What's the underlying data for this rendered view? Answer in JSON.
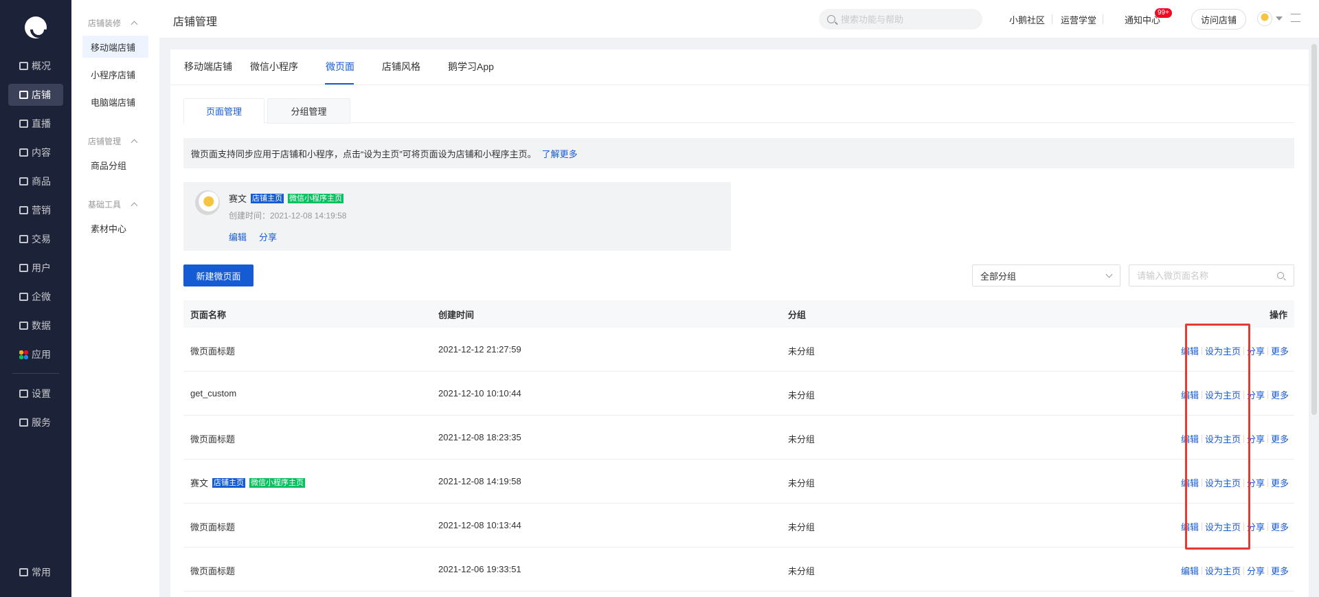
{
  "rail": {
    "items": [
      {
        "label": "概况"
      },
      {
        "label": "店铺"
      },
      {
        "label": "直播"
      },
      {
        "label": "内容"
      },
      {
        "label": "商品"
      },
      {
        "label": "营销"
      },
      {
        "label": "交易"
      },
      {
        "label": "用户"
      },
      {
        "label": "企微"
      },
      {
        "label": "数据"
      },
      {
        "label": "应用"
      },
      {
        "label": "设置"
      },
      {
        "label": "服务"
      },
      {
        "label": "常用"
      }
    ],
    "active": "店铺"
  },
  "subnav": {
    "groups": [
      {
        "title": "店铺装修",
        "items": [
          "移动端店铺",
          "小程序店铺",
          "电脑端店铺"
        ]
      },
      {
        "title": "店铺管理",
        "items": [
          "商品分组"
        ]
      },
      {
        "title": "基础工具",
        "items": [
          "素材中心"
        ]
      }
    ],
    "active": "移动端店铺"
  },
  "header": {
    "title": "店铺管理",
    "search_placeholder": "搜索功能与帮助",
    "links": [
      "小鹅社区",
      "运营学堂",
      "通知中心"
    ],
    "notice_badge": "99+",
    "visit_button": "访问店铺"
  },
  "tabs": {
    "items": [
      "移动端店铺",
      "微信小程序",
      "微页面",
      "店铺风格",
      "鹅学习App"
    ],
    "active": "微页面"
  },
  "subtabs": {
    "items": [
      "页面管理",
      "分组管理"
    ],
    "active": "页面管理"
  },
  "notice": {
    "text": "微页面支持同步应用于店铺和小程序，点击“设为主页”可将页面设为店铺和小程序主页。",
    "link": "了解更多"
  },
  "homepage": {
    "name": "赛文",
    "tag_shop": "店铺主页",
    "tag_mini": "微信小程序主页",
    "created": "创建时间：2021-12-08 14:19:58",
    "edit": "编辑",
    "share": "分享"
  },
  "toolbar": {
    "new_button": "新建微页面",
    "group_select": "全部分组",
    "search_placeholder": "请输入微页面名称"
  },
  "table": {
    "headers": [
      "页面名称",
      "创建时间",
      "分组",
      "操作"
    ],
    "ops": [
      "编辑",
      "设为主页",
      "分享",
      "更多"
    ],
    "rows": [
      {
        "name": "微页面标题",
        "time": "2021-12-12 21:27:59",
        "group": "未分组"
      },
      {
        "name": "get_custom",
        "time": "2021-12-10 10:10:44",
        "group": "未分组"
      },
      {
        "name": "微页面标题",
        "time": "2021-12-08 18:23:35",
        "group": "未分组"
      },
      {
        "name": "赛文",
        "time": "2021-12-08 14:19:58",
        "group": "未分组",
        "tag_shop": "店铺主页",
        "tag_mini": "微信小程序主页"
      },
      {
        "name": "微页面标题",
        "time": "2021-12-08 10:13:44",
        "group": "未分组"
      },
      {
        "name": "微页面标题",
        "time": "2021-12-06 19:33:51",
        "group": "未分组"
      }
    ]
  },
  "colors": {
    "primary": "#155bd4",
    "rail_bg": "#1c2237",
    "tag_green": "#07c160",
    "highlight": "#e53935"
  }
}
